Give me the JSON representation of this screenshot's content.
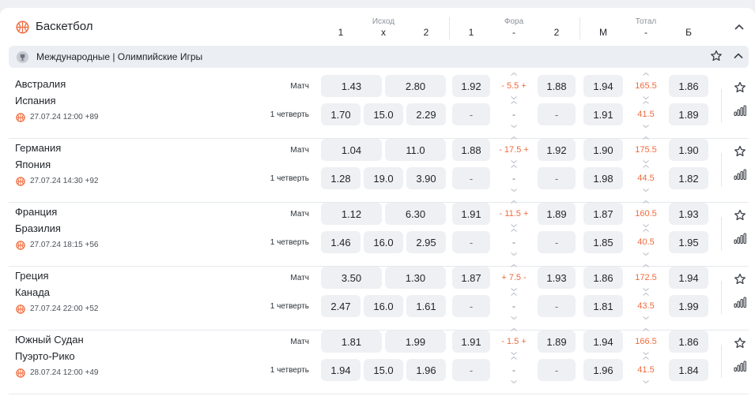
{
  "sport": {
    "title": "Баскетбол",
    "icon": "basketball-icon"
  },
  "header": {
    "groups": {
      "outcome": "Исход",
      "handicap": "Фора",
      "total": "Тотал"
    },
    "columns": [
      "1",
      "x",
      "2",
      "1",
      "-",
      "2",
      "М",
      "-",
      "Б"
    ]
  },
  "league": {
    "title": "Международные | Олимпийские Игры",
    "icon": "trophy-icon"
  },
  "row_labels": {
    "match": "Матч",
    "quarter": "1 четверть"
  },
  "colors": {
    "accent": "#f06a3c",
    "odd_bg": "#eef0f3",
    "text": "#1f2328"
  },
  "events": [
    {
      "team1": "Австралия",
      "team2": "Испания",
      "meta": "27.07.24 12:00 +89",
      "match": {
        "w1": "1.43",
        "w2": "2.80",
        "h1": "1.92",
        "hline": "- 5.5 +",
        "h2": "1.88",
        "tu": "1.94",
        "tline": "165.5",
        "to": "1.86"
      },
      "quarter": {
        "w1": "1.70",
        "x": "15.0",
        "w2": "2.29",
        "h1": "-",
        "hline": "-",
        "h2": "-",
        "tu": "1.91",
        "tline": "41.5",
        "to": "1.89"
      }
    },
    {
      "team1": "Германия",
      "team2": "Япония",
      "meta": "27.07.24 14:30 +92",
      "match": {
        "w1": "1.04",
        "w2": "11.0",
        "h1": "1.88",
        "hline": "- 17.5 +",
        "h2": "1.92",
        "tu": "1.90",
        "tline": "175.5",
        "to": "1.90"
      },
      "quarter": {
        "w1": "1.28",
        "x": "19.0",
        "w2": "3.90",
        "h1": "-",
        "hline": "-",
        "h2": "-",
        "tu": "1.98",
        "tline": "44.5",
        "to": "1.82"
      }
    },
    {
      "team1": "Франция",
      "team2": "Бразилия",
      "meta": "27.07.24 18:15 +56",
      "match": {
        "w1": "1.12",
        "w2": "6.30",
        "h1": "1.91",
        "hline": "- 11.5 +",
        "h2": "1.89",
        "tu": "1.87",
        "tline": "160.5",
        "to": "1.93"
      },
      "quarter": {
        "w1": "1.46",
        "x": "16.0",
        "w2": "2.95",
        "h1": "-",
        "hline": "-",
        "h2": "-",
        "tu": "1.85",
        "tline": "40.5",
        "to": "1.95"
      }
    },
    {
      "team1": "Греция",
      "team2": "Канада",
      "meta": "27.07.24 22:00 +52",
      "match": {
        "w1": "3.50",
        "w2": "1.30",
        "h1": "1.87",
        "hline": "+ 7.5 -",
        "h2": "1.93",
        "tu": "1.86",
        "tline": "172.5",
        "to": "1.94"
      },
      "quarter": {
        "w1": "2.47",
        "x": "16.0",
        "w2": "1.61",
        "h1": "-",
        "hline": "-",
        "h2": "-",
        "tu": "1.81",
        "tline": "43.5",
        "to": "1.99"
      }
    },
    {
      "team1": "Южный Судан",
      "team2": "Пуэрто-Рико",
      "meta": "28.07.24 12:00 +49",
      "match": {
        "w1": "1.81",
        "w2": "1.99",
        "h1": "1.91",
        "hline": "- 1.5 +",
        "h2": "1.89",
        "tu": "1.94",
        "tline": "166.5",
        "to": "1.86"
      },
      "quarter": {
        "w1": "1.94",
        "x": "15.0",
        "w2": "1.96",
        "h1": "-",
        "hline": "-",
        "h2": "-",
        "tu": "1.96",
        "tline": "41.5",
        "to": "1.84"
      }
    }
  ]
}
